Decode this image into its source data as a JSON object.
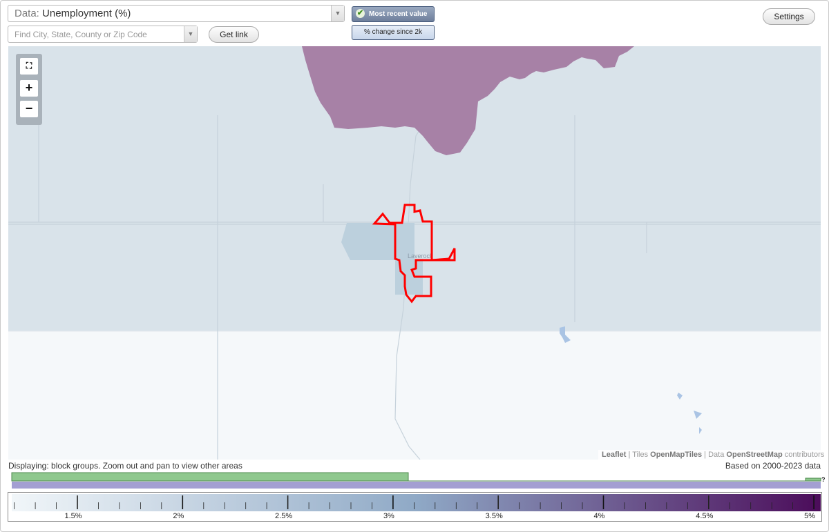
{
  "data_select": {
    "prefix": "Data:",
    "value": "Unemployment (%)"
  },
  "search": {
    "placeholder": "Find City, State, County or Zip Code"
  },
  "buttons": {
    "get_link": "Get link",
    "settings": "Settings"
  },
  "toggles": {
    "most_recent": "Most recent value",
    "pct_change": "% change since 2k",
    "most_recent_checked": true
  },
  "zoom": {
    "fullscreen_icon": "fullscreen-icon",
    "zoom_in": "+",
    "zoom_out": "−"
  },
  "map": {
    "place_label": "Laverock",
    "attribution": {
      "leaflet": "Leaflet",
      "tiles_prefix": "Tiles",
      "tiles": "OpenMapTiles",
      "data_prefix": "Data",
      "osm": "OpenStreetMap",
      "suffix": "contributors"
    },
    "colors": {
      "region_low": "#d9e3ea",
      "region_high": "#a781a6",
      "block_group": "#bcd0dd",
      "selected_outline": "#ff0000",
      "background": "#f5f8fa"
    }
  },
  "status": {
    "displaying": "Displaying: block groups. Zoom out and pan to view other areas",
    "based_on": "Based on 2000-2023 data"
  },
  "histogram": {
    "colors": {
      "count_bar": "#8fc88e",
      "range_bar": "#a39fd2"
    },
    "unknown_label": "?"
  },
  "legend": {
    "tick_labels": [
      "1.5%",
      "2%",
      "2.5%",
      "3%",
      "3.5%",
      "4%",
      "4.5%",
      "5%"
    ],
    "gradient_start": "#f1f6f9",
    "gradient_mid": "#8fa9c6",
    "gradient_end": "#4b0c5a"
  }
}
